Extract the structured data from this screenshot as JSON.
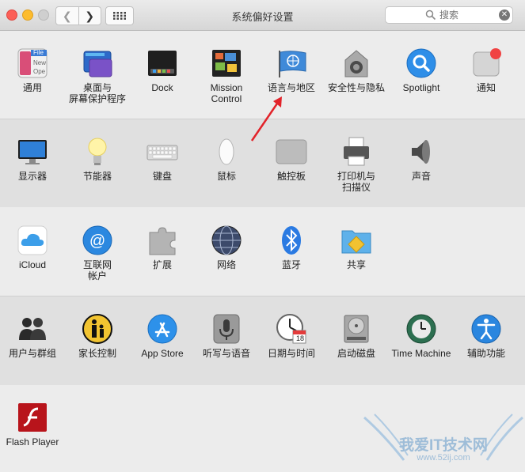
{
  "window": {
    "title": "系统偏好设置"
  },
  "search": {
    "placeholder": "搜索"
  },
  "rows": [
    {
      "items": [
        {
          "label": "通用",
          "icon": "general-icon"
        },
        {
          "label": "桌面与\n屏幕保护程序",
          "icon": "desktop-screensaver-icon"
        },
        {
          "label": "Dock",
          "icon": "dock-icon"
        },
        {
          "label": "Mission\nControl",
          "icon": "mission-control-icon"
        },
        {
          "label": "语言与地区",
          "icon": "language-region-icon"
        },
        {
          "label": "安全性与隐私",
          "icon": "security-privacy-icon"
        },
        {
          "label": "Spotlight",
          "icon": "spotlight-icon"
        },
        {
          "label": "通知",
          "icon": "notifications-icon"
        }
      ]
    },
    {
      "items": [
        {
          "label": "显示器",
          "icon": "displays-icon"
        },
        {
          "label": "节能器",
          "icon": "energy-saver-icon"
        },
        {
          "label": "键盘",
          "icon": "keyboard-icon"
        },
        {
          "label": "鼠标",
          "icon": "mouse-icon"
        },
        {
          "label": "触控板",
          "icon": "trackpad-icon"
        },
        {
          "label": "打印机与\n扫描仪",
          "icon": "printers-scanners-icon"
        },
        {
          "label": "声音",
          "icon": "sound-icon"
        }
      ]
    },
    {
      "items": [
        {
          "label": "iCloud",
          "icon": "icloud-icon"
        },
        {
          "label": "互联网\n帐户",
          "icon": "internet-accounts-icon"
        },
        {
          "label": "扩展",
          "icon": "extensions-icon"
        },
        {
          "label": "网络",
          "icon": "network-icon"
        },
        {
          "label": "蓝牙",
          "icon": "bluetooth-icon"
        },
        {
          "label": "共享",
          "icon": "sharing-icon"
        }
      ]
    },
    {
      "items": [
        {
          "label": "用户与群组",
          "icon": "users-groups-icon"
        },
        {
          "label": "家长控制",
          "icon": "parental-controls-icon"
        },
        {
          "label": "App Store",
          "icon": "app-store-icon"
        },
        {
          "label": "听写与语音",
          "icon": "dictation-speech-icon"
        },
        {
          "label": "日期与时间",
          "icon": "date-time-icon"
        },
        {
          "label": "启动磁盘",
          "icon": "startup-disk-icon"
        },
        {
          "label": "Time Machine",
          "icon": "time-machine-icon"
        },
        {
          "label": "辅助功能",
          "icon": "accessibility-icon"
        }
      ]
    },
    {
      "items": [
        {
          "label": "Flash Player",
          "icon": "flash-player-icon"
        }
      ]
    }
  ],
  "general_icon_text": [
    "File",
    "New",
    "Ope"
  ],
  "calendar_day": "18",
  "watermark": {
    "text": "我爱IT技术网",
    "url": "www.52ij.com"
  }
}
